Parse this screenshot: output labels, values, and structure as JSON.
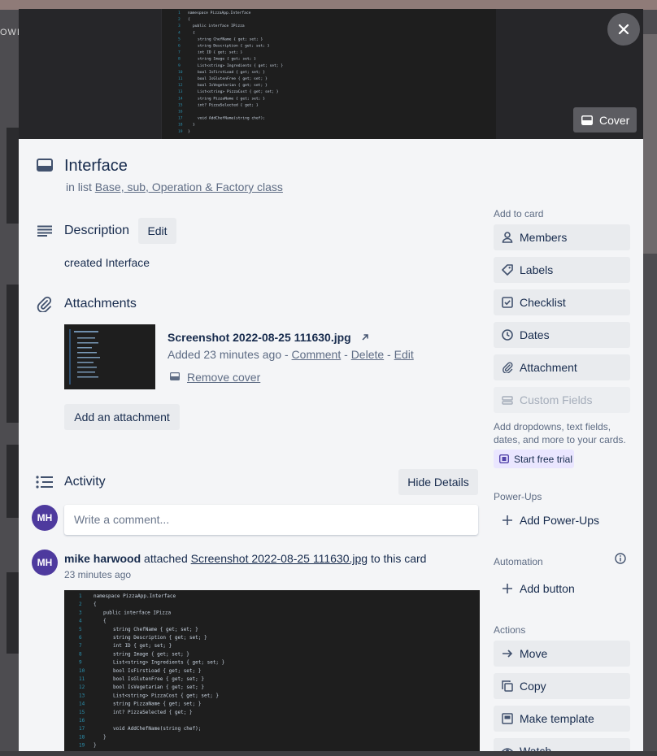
{
  "backdrop": {
    "crumb": "OWD"
  },
  "cover": {
    "code_lines": [
      {
        "n": "1",
        "t": "namespace PizzaApp.Interface"
      },
      {
        "n": "2",
        "t": "{"
      },
      {
        "n": "3",
        "t": "public interface IPizza"
      },
      {
        "n": "4",
        "t": "{"
      },
      {
        "n": "5",
        "t": "string ChefName { get; set; }"
      },
      {
        "n": "6",
        "t": "string Description { get; set; }"
      },
      {
        "n": "7",
        "t": "int ID { get; set; }"
      },
      {
        "n": "8",
        "t": "string Image { get; set; }"
      },
      {
        "n": "9",
        "t": "List<string> Ingredients { get; set; }"
      },
      {
        "n": "10",
        "t": "bool IsFirstLoad { get; set; }"
      },
      {
        "n": "11",
        "t": "bool IsGlutenFree { get; set; }"
      },
      {
        "n": "12",
        "t": "bool IsVegetarian { get; set; }"
      },
      {
        "n": "13",
        "t": "List<string> PizzaCost { get; set; }"
      },
      {
        "n": "14",
        "t": "string PizzaName { get; set; }"
      },
      {
        "n": "15",
        "t": "int? PizzaSelected { get; }"
      },
      {
        "n": "16",
        "t": ""
      },
      {
        "n": "17",
        "t": "void AddChefName(string chef);"
      },
      {
        "n": "18",
        "t": "}"
      },
      {
        "n": "19",
        "t": "}"
      }
    ],
    "cover_button_label": "Cover"
  },
  "card": {
    "title": "Interface",
    "in_list_prefix": "in list",
    "list_name": "Base, sub, Operation & Factory class"
  },
  "description": {
    "heading": "Description",
    "edit_label": "Edit",
    "text": "created Interface"
  },
  "attachments": {
    "heading": "Attachments",
    "file_name": "Screenshot 2022-08-25 111630.jpg",
    "added_text": "Added 23 minutes ago - ",
    "comment_link": "Comment",
    "sep1": " - ",
    "delete_link": "Delete",
    "sep2": " - ",
    "edit_link": "Edit",
    "remove_cover": "Remove cover",
    "add_button": "Add an attachment"
  },
  "activity": {
    "heading": "Activity",
    "hide_details": "Hide Details",
    "comment_placeholder": "Write a comment...",
    "avatar_initials": "MH",
    "entry_user": "mike harwood",
    "entry_action": " attached ",
    "entry_file": "Screenshot 2022-08-25 111630.jpg",
    "entry_suffix": " to this card",
    "entry_time": "23 minutes ago"
  },
  "sidebar": {
    "add_to_card_label": "Add to card",
    "add_items": [
      {
        "label": "Members",
        "icon": "person-icon"
      },
      {
        "label": "Labels",
        "icon": "tag-icon"
      },
      {
        "label": "Checklist",
        "icon": "checklist-icon"
      },
      {
        "label": "Dates",
        "icon": "clock-icon"
      },
      {
        "label": "Attachment",
        "icon": "paperclip-icon"
      },
      {
        "label": "Custom Fields",
        "icon": "custom-fields-icon"
      }
    ],
    "custom_fields_hint": "Add dropdowns, text fields, dates, and more to your cards.",
    "trial_label": "Start free trial",
    "powerups_label": "Power-Ups",
    "add_powerups": "Add Power-Ups",
    "automation_label": "Automation",
    "add_button": "Add button",
    "actions_label": "Actions",
    "action_items": [
      {
        "label": "Move",
        "icon": "arrow-right-icon"
      },
      {
        "label": "Copy",
        "icon": "copy-icon"
      },
      {
        "label": "Make template",
        "icon": "template-icon"
      },
      {
        "label": "Watch",
        "icon": "eye-icon"
      }
    ]
  },
  "colors": {
    "modal_bg": "#f4f5f7",
    "button_bg": "#e9ebee",
    "avatar_bg": "#4e3a9e",
    "trial_bg": "#eae6ff",
    "code_bg": "#1e1e1e",
    "text": "#172b4d",
    "muted": "#5e6c84"
  }
}
